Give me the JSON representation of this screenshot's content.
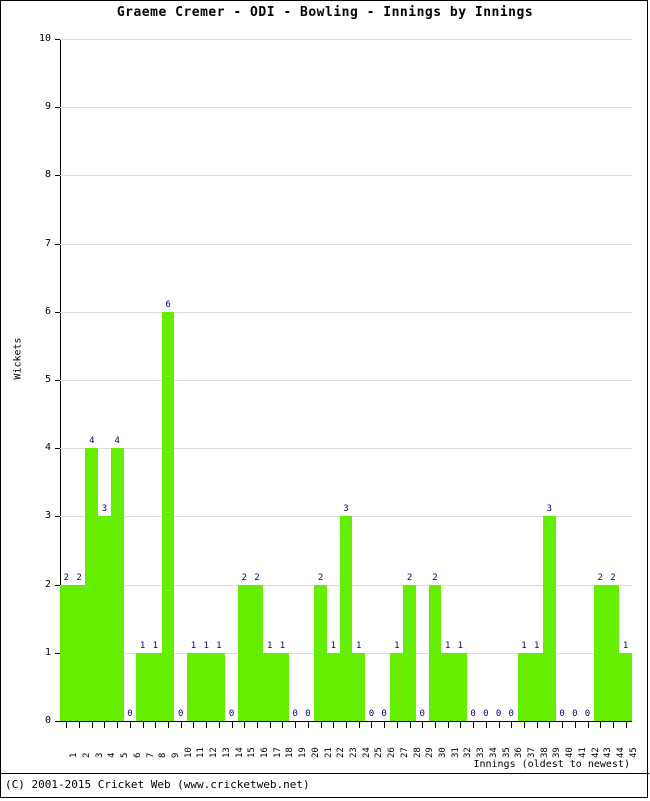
{
  "chart_data": {
    "type": "bar",
    "title": "Graeme Cremer - ODI - Bowling - Innings by Innings",
    "xlabel": "Innings (oldest to newest)",
    "ylabel": "Wickets",
    "ylim": [
      0,
      10
    ],
    "ytick_labels": [
      "0",
      "1",
      "2",
      "3",
      "4",
      "5",
      "6",
      "7",
      "8",
      "9",
      "10"
    ],
    "yticks": [
      0,
      1,
      2,
      3,
      4,
      5,
      6,
      7,
      8,
      9,
      10
    ],
    "grid": true,
    "legend": "none",
    "bar_color": "#66ee00",
    "value_label_color": "#000080",
    "categories": [
      "1",
      "2",
      "3",
      "4",
      "5",
      "6",
      "7",
      "8",
      "9",
      "10",
      "11",
      "12",
      "13",
      "14",
      "15",
      "16",
      "17",
      "18",
      "19",
      "20",
      "21",
      "22",
      "23",
      "24",
      "25",
      "26",
      "27",
      "28",
      "29",
      "30",
      "31",
      "32",
      "33",
      "34",
      "35",
      "36",
      "37",
      "38",
      "39",
      "40",
      "41",
      "42",
      "43",
      "44",
      "45"
    ],
    "values": [
      2,
      2,
      4,
      3,
      4,
      0,
      1,
      1,
      6,
      0,
      1,
      1,
      1,
      0,
      2,
      2,
      1,
      1,
      0,
      0,
      2,
      1,
      3,
      1,
      0,
      0,
      1,
      2,
      0,
      2,
      1,
      1,
      0,
      0,
      0,
      0,
      1,
      1,
      3,
      0,
      0,
      0,
      2,
      2,
      1
    ],
    "data_labels": [
      "2",
      "2",
      "4",
      "3",
      "4",
      "0",
      "1",
      "1",
      "6",
      "0",
      "1",
      "1",
      "1",
      "0",
      "2",
      "2",
      "1",
      "1",
      "0",
      "0",
      "2",
      "1",
      "3",
      "1",
      "0",
      "0",
      "1",
      "2",
      "0",
      "2",
      "1",
      "1",
      "0",
      "0",
      "0",
      "0",
      "1",
      "1",
      "3",
      "0",
      "0",
      "0",
      "2",
      "2",
      "1"
    ]
  },
  "footer": {
    "copyright": "(C) 2001-2015 Cricket Web (www.cricketweb.net)"
  }
}
